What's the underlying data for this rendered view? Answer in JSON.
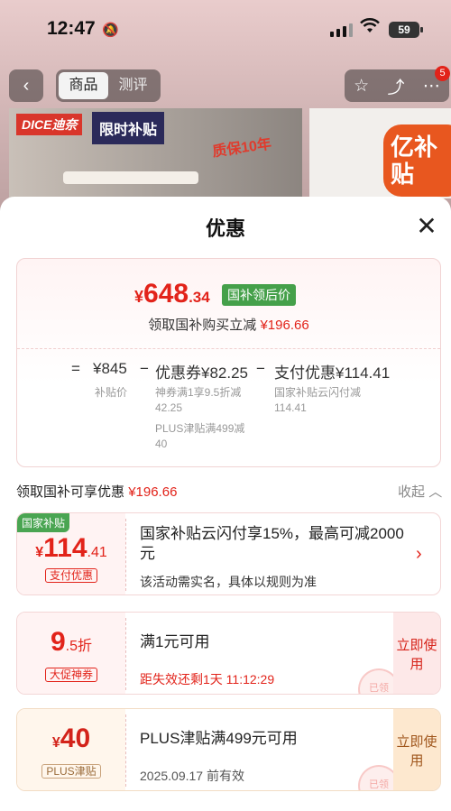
{
  "status_bar": {
    "time": "12:47",
    "battery": "59"
  },
  "nav": {
    "tabs": [
      "商品",
      "测评"
    ],
    "badge": "5"
  },
  "banner": {
    "logo": "DICE迪奈",
    "promo": "限时补贴",
    "warranty": "质保10年",
    "right_badge": "亿补贴"
  },
  "sheet": {
    "title": "优惠",
    "summary": {
      "price_currency": "¥",
      "price_int": "648",
      "price_dec": ".34",
      "price_tag": "国补领后价",
      "save_text": "领取国补购买立减",
      "save_amount": "¥196.66",
      "formula": {
        "eq": "=",
        "base": "¥845",
        "base_label": "补贴价",
        "minus1": "−",
        "coupon": "优惠券¥82.25",
        "coupon_detail_1": "神券满1享9.5折减",
        "coupon_detail_1b": "42.25",
        "coupon_detail_2": "PLUS津贴满499减",
        "coupon_detail_2b": "40",
        "minus2": "−",
        "pay": "支付优惠¥114.41",
        "pay_detail": "国家补贴云闪付减",
        "pay_detail_b": "114.41"
      }
    },
    "section": {
      "label": "领取国补可享优惠",
      "amount": "¥196.66",
      "collapse": "收起"
    },
    "cards": [
      {
        "ribbon": "国家补贴",
        "currency": "¥",
        "int": "114",
        "dec": ".41",
        "tag": "支付优惠",
        "title": "国家补贴云闪付享15%，最高可减2000元",
        "sub": "该活动需实名，具体以规则为准"
      },
      {
        "int": "9",
        "dec": ".5折",
        "tag": "大促神券",
        "title": "满1元可用",
        "sub": "距失效还剩1天 11:12:29",
        "button": "立即使用",
        "stamp": "已领"
      },
      {
        "currency": "¥",
        "int": "40",
        "tag": "PLUS津贴",
        "title": "PLUS津贴满499元可用",
        "sub": "2025.09.17 前有效",
        "button": "立即使用",
        "stamp": "已领"
      }
    ]
  }
}
